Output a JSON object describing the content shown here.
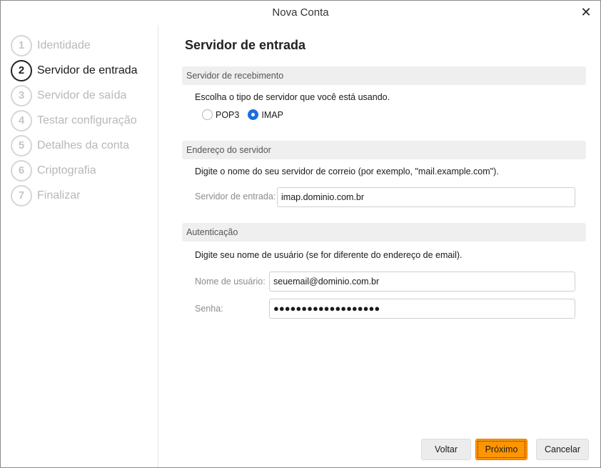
{
  "window": {
    "title": "Nova Conta",
    "close_glyph": "✕"
  },
  "steps": [
    {
      "num": "1",
      "label": "Identidade",
      "active": false
    },
    {
      "num": "2",
      "label": "Servidor de entrada",
      "active": true
    },
    {
      "num": "3",
      "label": "Servidor de saída",
      "active": false
    },
    {
      "num": "4",
      "label": "Testar configuração",
      "active": false
    },
    {
      "num": "5",
      "label": "Detalhes da conta",
      "active": false
    },
    {
      "num": "6",
      "label": "Criptografia",
      "active": false
    },
    {
      "num": "7",
      "label": "Finalizar",
      "active": false
    }
  ],
  "main": {
    "heading": "Servidor de entrada",
    "receiving": {
      "section_title": "Servidor de recebimento",
      "description": "Escolha o tipo de servidor que você está usando.",
      "options": [
        {
          "label": "POP3",
          "checked": false
        },
        {
          "label": "IMAP",
          "checked": true
        }
      ]
    },
    "server_address": {
      "section_title": "Endereço do servidor",
      "description": "Digite o nome do seu servidor de correio (por exemplo, \"mail.example.com\").",
      "incoming_label": "Servidor de entrada:",
      "incoming_value": "imap.dominio.com.br"
    },
    "auth": {
      "section_title": "Autenticação",
      "description": "Digite seu nome de usuário (se for diferente do endereço de email).",
      "username_label": "Nome de usuário:",
      "username_value": "seuemail@dominio.com.br",
      "password_label": "Senha:",
      "password_value": "●●●●●●●●●●●●●●●●●●●"
    }
  },
  "buttons": {
    "back": "Voltar",
    "next": "Próximo",
    "cancel": "Cancelar"
  },
  "colors": {
    "accent": "#ff9500",
    "radio_selected": "#1a6fe0",
    "section_bg": "#efefef"
  }
}
